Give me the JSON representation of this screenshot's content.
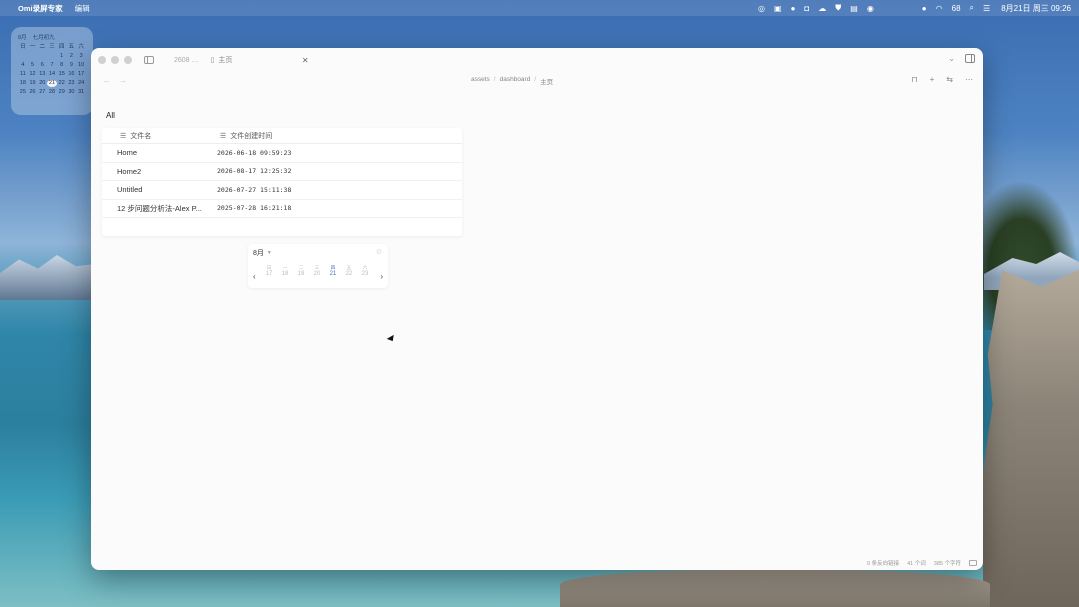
{
  "menubar": {
    "app_name": "Omi录屏专家",
    "menu_edit": "编辑",
    "battery": "68",
    "clock": "8月21日 周三 09:26"
  },
  "calendar_widget": {
    "month": "8月",
    "lunar": "七月初九",
    "weekdays": [
      "日",
      "一",
      "二",
      "三",
      "四",
      "五",
      "六"
    ],
    "days": [
      "",
      "",
      "",
      "",
      "1",
      "2",
      "3",
      "4",
      "5",
      "6",
      "7",
      "8",
      "9",
      "10",
      "11",
      "12",
      "13",
      "14",
      "15",
      "16",
      "17",
      "18",
      "19",
      "20",
      "21",
      "22",
      "23",
      "24",
      "25",
      "26",
      "27",
      "28",
      "29",
      "30",
      "31"
    ],
    "today": "21"
  },
  "window": {
    "tabs": [
      {
        "label": "2608"
      },
      {
        "label": "主页"
      }
    ],
    "breadcrumb": [
      "assets",
      "dashboard",
      "主页"
    ],
    "view_title": "All",
    "table": {
      "columns": [
        "文件名",
        "文件创建时间"
      ],
      "rows": [
        {
          "name": "Home",
          "created": "2026-06-18 09:59:23"
        },
        {
          "name": "Home2",
          "created": "2026-08-17 12:25:32"
        },
        {
          "name": "Untitled",
          "created": "2026-07-27 15:11:38"
        },
        {
          "name": "12 步问题分析法-Alex P...",
          "created": "2025-07-28 16:21:18"
        }
      ]
    },
    "datepicker": {
      "month": "8月",
      "days": [
        {
          "wd": "日",
          "dn": "17"
        },
        {
          "wd": "一",
          "dn": "18"
        },
        {
          "wd": "二",
          "dn": "19"
        },
        {
          "wd": "三",
          "dn": "20"
        },
        {
          "wd": "四",
          "dn": "21",
          "selected": true
        },
        {
          "wd": "五",
          "dn": "22"
        },
        {
          "wd": "六",
          "dn": "23"
        }
      ]
    },
    "status": {
      "backlinks": "0 条反向链接",
      "chars": "41 个词",
      "words": "385 个字符"
    }
  }
}
